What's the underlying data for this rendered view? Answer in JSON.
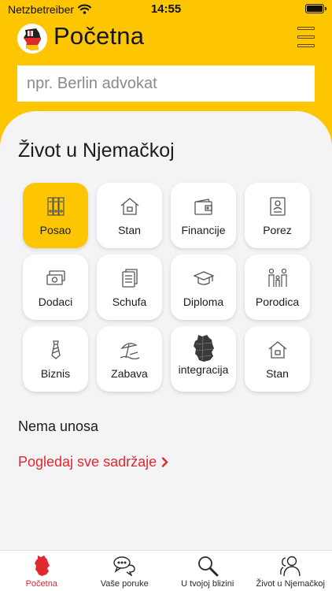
{
  "status_bar": {
    "carrier": "Netzbetreiber",
    "time": "14:55"
  },
  "header": {
    "title": "Početna"
  },
  "search": {
    "placeholder": "npr. Berlin advokat"
  },
  "section": {
    "title": "Život u Njemačkoj"
  },
  "categories": [
    {
      "label": "Posao",
      "icon": "binders-icon",
      "selected": true
    },
    {
      "label": "Stan",
      "icon": "house-icon"
    },
    {
      "label": "Financije",
      "icon": "wallet-icon"
    },
    {
      "label": "Porez",
      "icon": "tax-document-icon"
    },
    {
      "label": "Dodaci",
      "icon": "money-icon"
    },
    {
      "label": "Schufa",
      "icon": "documents-icon"
    },
    {
      "label": "Diploma",
      "icon": "graduation-cap-icon"
    },
    {
      "label": "Porodica",
      "icon": "family-icon"
    },
    {
      "label": "Biznis",
      "icon": "tie-icon"
    },
    {
      "label": "Zabava",
      "icon": "beach-icon"
    },
    {
      "label": "integracija",
      "icon": "germany-map-icon"
    },
    {
      "label": "Stan",
      "icon": "house-icon"
    }
  ],
  "empty_state": {
    "text": "Nema unosa"
  },
  "see_all": {
    "label": "Pogledaj sve sadržaje"
  },
  "tabs": [
    {
      "label": "Početna",
      "icon": "germany-map-icon",
      "active": true
    },
    {
      "label": "Vaše poruke",
      "icon": "chat-bubbles-icon"
    },
    {
      "label": "U tvojoj blizini",
      "icon": "magnifier-icon"
    },
    {
      "label": "Život u Njemačkoj",
      "icon": "people-icon"
    }
  ],
  "colors": {
    "accent": "#fec601",
    "link": "#e0282f",
    "background": "#f4f4f6"
  }
}
